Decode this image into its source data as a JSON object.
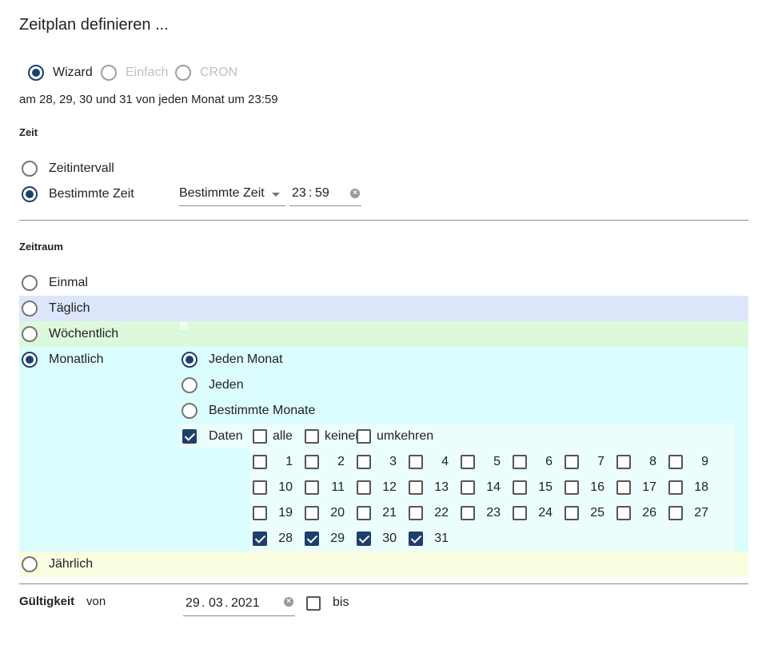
{
  "dialog": {
    "title": "Zeitplan definieren ...",
    "summary": "am 28, 29, 30 und 31 von jeden Monat um 23:59"
  },
  "mode": {
    "options": [
      "Wizard",
      "Einfach",
      "CRON"
    ],
    "selected": "Wizard"
  },
  "zeit": {
    "title": "Zeit",
    "options": [
      "Zeitintervall",
      "Bestimmte Zeit"
    ],
    "selected": "Bestimmte Zeit",
    "type_select": "Bestimmte Zeit",
    "time_hours": "23",
    "time_sep": ":",
    "time_minutes": "59"
  },
  "zeitraum": {
    "title": "Zeitraum",
    "options": [
      "Einmal",
      "Täglich",
      "Wöchentlich",
      "Monatlich",
      "Jährlich"
    ],
    "selected": "Monatlich",
    "monthly": {
      "options": [
        "Jeden Monat",
        "Jeden",
        "Bestimmte Monate"
      ],
      "selected": "Jeden Monat",
      "dates_label": "Daten",
      "dates_checked": true,
      "all_label": "alle",
      "none_label": "keiner",
      "invert_label": "umkehren",
      "days": [
        "1",
        "2",
        "3",
        "4",
        "5",
        "6",
        "7",
        "8",
        "9",
        "10",
        "11",
        "12",
        "13",
        "14",
        "15",
        "16",
        "17",
        "18",
        "19",
        "20",
        "21",
        "22",
        "23",
        "24",
        "25",
        "26",
        "27",
        "28",
        "29",
        "30",
        "31"
      ],
      "checked_days": [
        "28",
        "29",
        "30",
        "31"
      ]
    }
  },
  "gueltigkeit": {
    "label": "Gültigkeit",
    "from_label": "von",
    "from_day": "29",
    "from_month": "03",
    "from_year": "2021",
    "date_sep": ".",
    "to_label": "bis"
  },
  "colors": {
    "accent": "#1d3f6e",
    "band_daily": "#dde7fb",
    "band_weekly": "#dcfadb",
    "band_monthly": "#dbfdfd",
    "band_yearly": "#fbfde1"
  }
}
